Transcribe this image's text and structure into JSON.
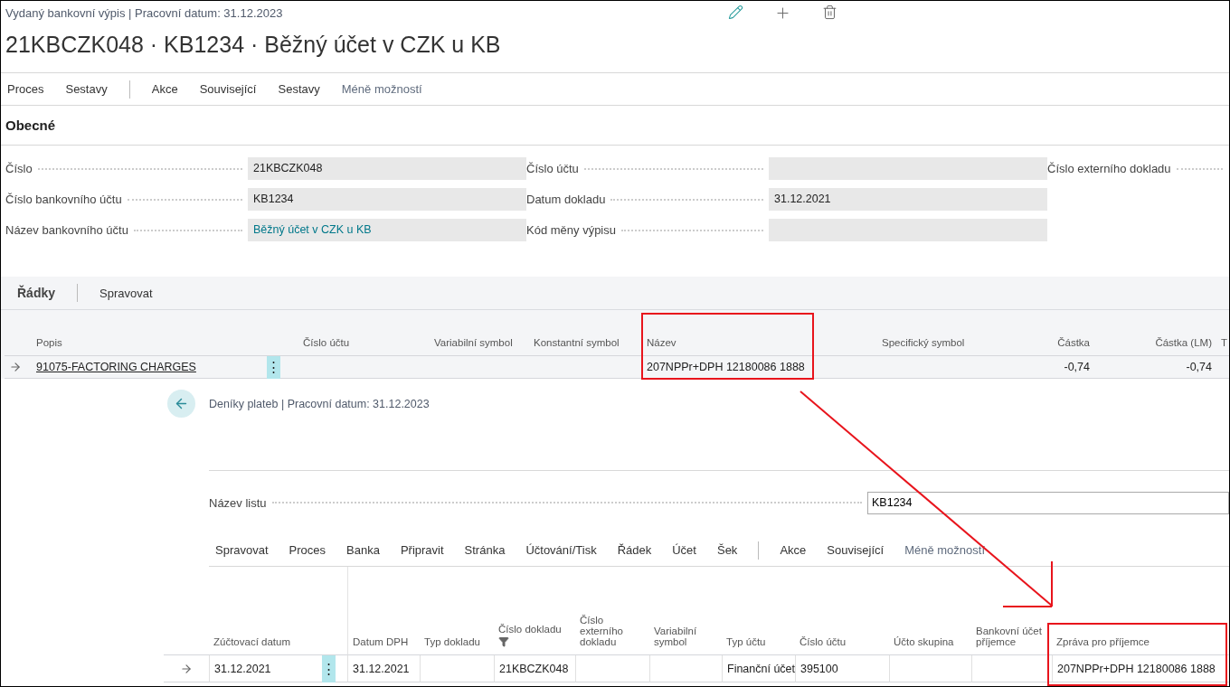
{
  "header": {
    "breadcrumb": "Vydaný bankovní výpis | Pracovní datum: 31.12.2023",
    "title": "21KBCZK048 · KB1234 · Běžný účet v CZK u KB"
  },
  "action_bar": [
    {
      "kind": "action",
      "label": "Proces"
    },
    {
      "kind": "action",
      "label": "Sestavy"
    },
    {
      "kind": "separator"
    },
    {
      "kind": "action",
      "label": "Akce"
    },
    {
      "kind": "action",
      "label": "Související"
    },
    {
      "kind": "action",
      "label": "Sestavy"
    },
    {
      "kind": "more",
      "label": "Méně možností"
    }
  ],
  "general": {
    "title": "Obecné",
    "columns": [
      [
        {
          "kind": "text",
          "label": "Číslo",
          "value": "21KBCZK048"
        },
        {
          "kind": "text",
          "label": "Číslo bankovního účtu",
          "value": "KB1234"
        },
        {
          "kind": "link",
          "label": "Název bankovního účtu",
          "value": "Běžný účet v CZK u KB"
        }
      ],
      [
        {
          "kind": "text",
          "label": "Číslo účtu"
        },
        {
          "kind": "text",
          "label": "Datum dokladu",
          "value": "31.12.2021"
        },
        {
          "kind": "text",
          "label": "Kód měny výpisu"
        }
      ],
      [
        {
          "kind": "offscreen",
          "label": "Číslo externího dokladu"
        }
      ]
    ]
  },
  "lines": {
    "title": "Řádky",
    "actions": [
      "Spravovat"
    ],
    "columns": [
      {
        "label": "Popis",
        "numeric": false
      },
      {
        "label": "Číslo účtu",
        "numeric": false
      },
      {
        "label": "Variabilní symbol",
        "numeric": false
      },
      {
        "label": "Konstantní symbol",
        "numeric": false
      },
      {
        "label": "Název",
        "numeric": false
      },
      {
        "label": "Specifický symbol",
        "numeric": false
      },
      {
        "label": "Částka",
        "numeric": true
      },
      {
        "label": "Částka (LM)",
        "numeric": true
      },
      {
        "label": "T"
      }
    ],
    "rows": [
      {
        "menu": "⋮",
        "cells": [
          "91075-FACTORING CHARGES",
          null,
          null,
          null,
          "207NPPr+DPH 12180086 1888",
          null,
          "-0,74",
          "-0,74",
          null
        ]
      }
    ]
  },
  "journal": {
    "breadcrumb": "Deníky plateb | Pracovní datum: 31.12.2023",
    "batch": {
      "label": "Název listu",
      "value": "KB1234"
    },
    "actions": [
      {
        "kind": "action",
        "label": "Spravovat"
      },
      {
        "kind": "action",
        "label": "Proces"
      },
      {
        "kind": "action",
        "label": "Banka"
      },
      {
        "kind": "action",
        "label": "Připravit"
      },
      {
        "kind": "action",
        "label": "Stránka"
      },
      {
        "kind": "action",
        "label": "Účtování/Tisk"
      },
      {
        "kind": "action",
        "label": "Řádek"
      },
      {
        "kind": "action",
        "label": "Účet"
      },
      {
        "kind": "action",
        "label": "Šek"
      },
      {
        "kind": "separator"
      },
      {
        "kind": "action",
        "label": "Akce"
      },
      {
        "kind": "action",
        "label": "Související"
      },
      {
        "kind": "more",
        "label": "Méně možností"
      }
    ],
    "columns": [
      {
        "label": "Zúčtovací datum",
        "filtered": false
      },
      {
        "label": "Datum DPH",
        "filtered": false
      },
      {
        "label": "Typ dokladu",
        "filtered": false
      },
      {
        "label": "Číslo dokladu",
        "filtered": true
      },
      {
        "label": "Číslo externího dokladu",
        "filtered": false
      },
      {
        "label": "Variabilní symbol",
        "filtered": false
      },
      {
        "label": "Typ účtu",
        "filtered": false
      },
      {
        "label": "Číslo účtu",
        "filtered": false
      },
      {
        "label": "Účto skupina",
        "filtered": false
      },
      {
        "label": "Bankovní účet příjemce",
        "filtered": false
      },
      {
        "label": "Zpráva pro příjemce",
        "filtered": false
      }
    ],
    "rows": [
      {
        "menu": "⋮",
        "cells": [
          "31.12.2021",
          "31.12.2021",
          null,
          "21KBCZK048",
          null,
          null,
          "Finanční účet",
          "395100",
          null,
          null,
          "207NPPr+DPH 12180086 1888"
        ]
      }
    ]
  }
}
